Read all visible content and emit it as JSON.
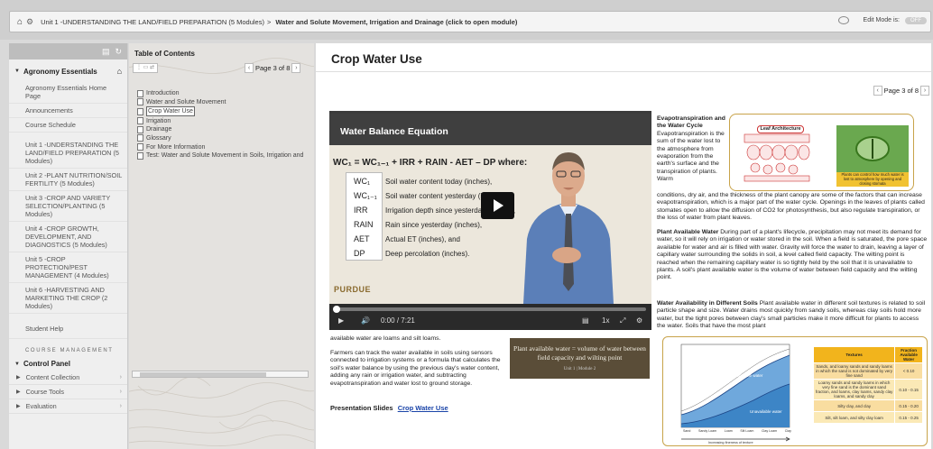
{
  "topbar": {
    "breadcrumb": {
      "parent": "Unit 1 -UNDERSTANDING THE LAND/FIELD PREPARATION (5 Modules)",
      "separator": ">",
      "current": "Water and Solute Movement, Irrigation and Drainage (click to open module)"
    },
    "edit_mode_label": "Edit Mode is:",
    "edit_mode_state": "OFF"
  },
  "sidebar": {
    "course_title": "Agronomy Essentials",
    "items": [
      "Agronomy Essentials Home Page",
      "Announcements",
      "Course Schedule",
      "Unit 1 -UNDERSTANDING THE LAND/FIELD PREPARATION (5 Modules)",
      "Unit 2 -PLANT NUTRITION/SOIL FERTILITY (5 Modules)",
      "Unit 3 -CROP AND VARIETY SELECTION/PLANTING (5 Modules)",
      "Unit 4 -CROP GROWTH, DEVELOPMENT, AND DIAGNOSTICS (5 Modules)",
      "Unit 5 -CROP PROTECTION/PEST MANAGEMENT (4 Modules)",
      "Unit 6 -HARVESTING AND MARKETING THE CROP (2 Modules)",
      "Student Help"
    ],
    "management_label": "COURSE MANAGEMENT",
    "control_panel": "Control Panel",
    "panel_items": [
      "Content Collection",
      "Course Tools",
      "Evaluation"
    ]
  },
  "toc": {
    "title": "Table of Contents",
    "page_label": "Page 3 of 8",
    "items": [
      "Introduction",
      "Water and Solute Movement",
      "Crop Water Use",
      "Irrigation",
      "Drainage",
      "Glossary",
      "For More Information",
      "Test: Water and Solute Movement in Soils, Irrigation and"
    ],
    "active_index": 2
  },
  "main": {
    "title": "Crop Water Use",
    "page_label": "Page 3 of 8",
    "video": {
      "heading": "Water Balance Equation",
      "equation": "WC₁ = WC₁₋₁ + IRR + RAIN - AET – DP  where:",
      "terms": [
        {
          "abbr": "WC₁",
          "desc": "Soil water content today (inches),"
        },
        {
          "abbr": "WC₁₋₁",
          "desc": "Soil water content yesterday (inches),"
        },
        {
          "abbr": "IRR",
          "desc": "Irrigation depth since yesterday (inches),"
        },
        {
          "abbr": "RAIN",
          "desc": "Rain since yesterday (inches),"
        },
        {
          "abbr": "AET",
          "desc": "Actual ET (inches), and"
        },
        {
          "abbr": "DP",
          "desc": "Deep percolation (inches)."
        }
      ],
      "logo": "PURDUE",
      "time": "0:00",
      "duration": "7:21",
      "time_sep": "/",
      "speed": "1x",
      "progress": 0
    },
    "below_video_text": "available water are loams and silt loams.",
    "farmers_text": "Farmers can track the water available in soils using sensors connected to irrigation systems or a formula that calculates the soil's water balance by using the previous day's water content, adding any rain or irrigation water, and subtracting evapotranspiration and water lost to ground storage.",
    "graphic_box": "Plant available water = volume of water between field capacity and wilting point",
    "graphic_box_sub": "Unit 1 | Module 2",
    "presentation_label": "Presentation Slides",
    "presentation_link": "Crop Water Use",
    "et_heading": "Evapotranspiration and the Water Cycle",
    "et_lead": "Evapotranspiration is the sum of the water lost to the atmosphere from evaporation from the earth's surface and the transpiration of plants. Warm",
    "et_text": "conditions, dry air, and the thickness of the plant canopy are some of the factors that can increase evapotranspiration, which is a major part of the water cycle. Openings in the leaves of plants called stomates open to allow the diffusion of CO2 for photosynthesis, but also regulate transpiration, or the loss of water from plant leaves.",
    "paw_heading": "Plant Available Water",
    "paw_text": "During part of a plant's lifecycle, precipitation may not meet its demand for water, so it will rely on irrigation or water stored in the soil. When a field is saturated, the pore space available for water and air is filled with water. Gravity will force the water to drain, leaving a layer of capillary water surrounding the solids in soil, a level called field capacity. The wilting point is reached when the remaining capillary water is so tightly held by the soil that it is unavailable to plants. A soil's plant available water is the volume of water between field capacity and the wilting point.",
    "wa_heading": "Water Availability in Different Soils",
    "wa_text": "Plant available water in different soil textures is related to soil particle shape and size. Water drains most quickly from sandy soils, whereas clay soils hold more water, but the tight pores between clay's small particles make it more difficult for plants to access the water. Soils that have the most plant",
    "leaf_figure": {
      "title": "Leaf Architecture",
      "caption": "Plants can control how much water is lost to atmosphere by opening and closing stomata"
    },
    "soil_figure": {
      "labels": [
        "Available water",
        "Unavailable water"
      ],
      "x_categories": [
        "Sand",
        "Sandy Loam",
        "Loam",
        "Silt Loam",
        "Clay Loam",
        "Clay"
      ],
      "x_label": "Increasing fineness of texture",
      "table_headers": [
        "Textures",
        "Fraction Available Water"
      ],
      "table_rows": [
        [
          "Sands, and loamy sands and sandy loams in which the sand is not dominated by very fine sand",
          "< 0.10"
        ],
        [
          "Loamy sands and sandy loams in which very fine sand is the dominant sand fraction, and loams, clay loams, sandy clay loams, and sandy clay",
          "0.10 - 0.15"
        ],
        [
          "Silty clay, and clay",
          "0.15 - 0.20"
        ],
        [
          "Silt, silt loam, and silty clay loam",
          "0.15 - 0.25"
        ]
      ]
    }
  }
}
